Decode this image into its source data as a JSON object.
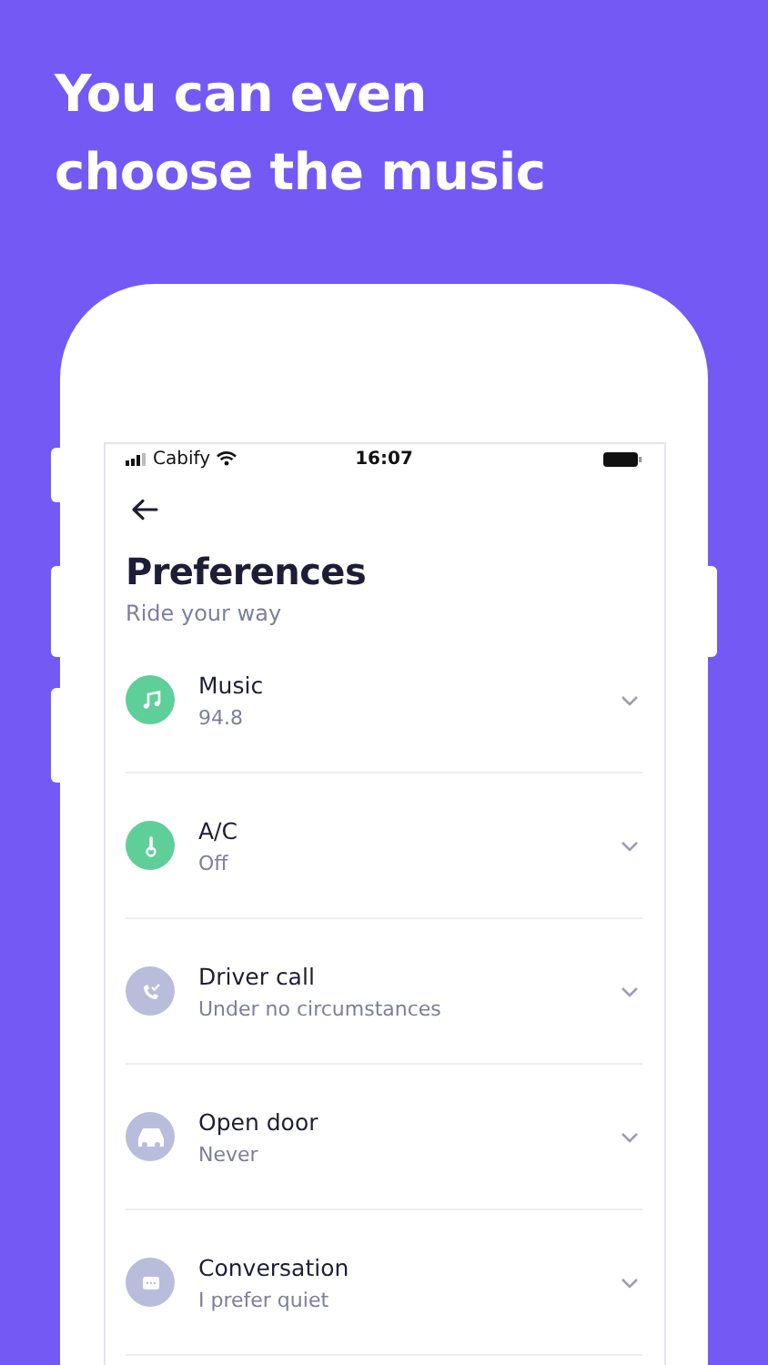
{
  "headline": "You can even choose the music",
  "status_bar": {
    "carrier": "Cabify",
    "time": "16:07"
  },
  "header": {
    "title": "Preferences",
    "subtitle": "Ride your way"
  },
  "preferences": [
    {
      "kind": "music",
      "title": "Music",
      "value": "94.8",
      "color": "#5fcf99"
    },
    {
      "kind": "temperature",
      "title": "A/C",
      "value": "Off",
      "color": "#5fcf99"
    },
    {
      "kind": "call",
      "title": "Driver call",
      "value": "Under no circumstances",
      "color": "#b9bddc"
    },
    {
      "kind": "door",
      "title": "Open door",
      "value": "Never",
      "color": "#b9bddc"
    },
    {
      "kind": "chat",
      "title": "Conversation",
      "value": "I prefer quiet",
      "color": "#b9bddc"
    }
  ]
}
